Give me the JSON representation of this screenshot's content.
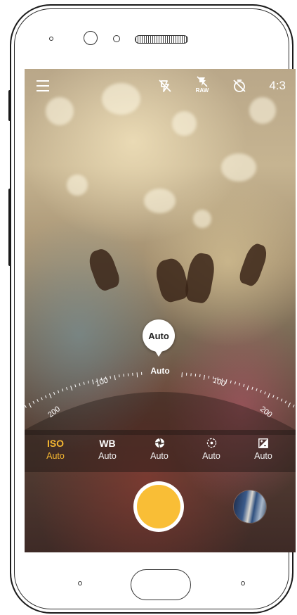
{
  "top_bar": {
    "menu_icon": "menu-icon",
    "flash_icon": "flash-off-icon",
    "raw_icon": "raw-off-icon",
    "raw_label": "RAW",
    "timer_icon": "timer-off-icon",
    "aspect_ratio": "4:3"
  },
  "dial": {
    "bubble_value": "Auto",
    "center_label": "Auto",
    "tick_labels": [
      "200",
      "100",
      "100",
      "200"
    ]
  },
  "modes": [
    {
      "label": "ISO",
      "value": "Auto",
      "icon": "",
      "active": true
    },
    {
      "label": "WB",
      "value": "Auto",
      "icon": "",
      "active": false
    },
    {
      "label": "",
      "value": "Auto",
      "icon": "aperture-icon",
      "active": false
    },
    {
      "label": "",
      "value": "Auto",
      "icon": "focus-icon",
      "active": false
    },
    {
      "label": "",
      "value": "Auto",
      "icon": "exposure-icon",
      "active": false
    }
  ],
  "colors": {
    "accent": "#f5b731",
    "shutter": "#f9be36"
  }
}
